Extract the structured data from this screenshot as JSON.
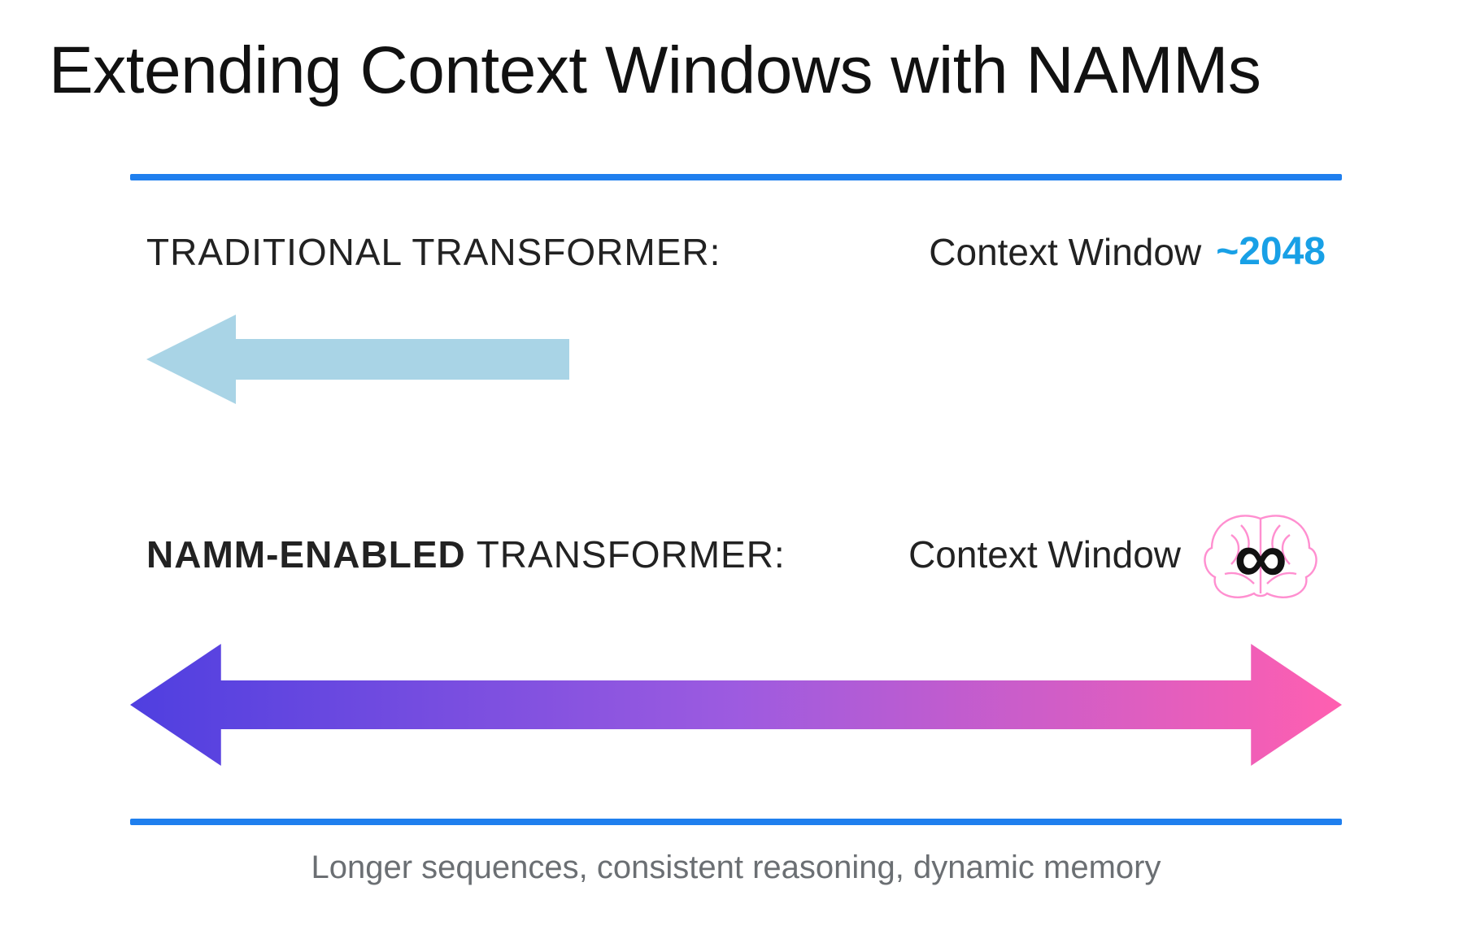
{
  "title": "Extending Context Windows with NAMMs",
  "top": {
    "label_prefix": "TRADITIONAL TRANSFORMER:",
    "cw_label": "Context Window",
    "cw_value": "~2048"
  },
  "bottom": {
    "label_bold": "NAMM-ENABLED",
    "label_rest": " TRANSFORMER:",
    "cw_label": "Context Window",
    "infinity": "∞"
  },
  "caption": "Longer sequences, consistent reasoning, dynamic memory",
  "colors": {
    "rule": "#1f7fee",
    "short_arrow": "#a9d4e6",
    "grad_start": "#4f3fe0",
    "grad_end": "#ff5fb0",
    "brain_stroke": "#ff8fd0",
    "highlight": "#18a0e6"
  }
}
